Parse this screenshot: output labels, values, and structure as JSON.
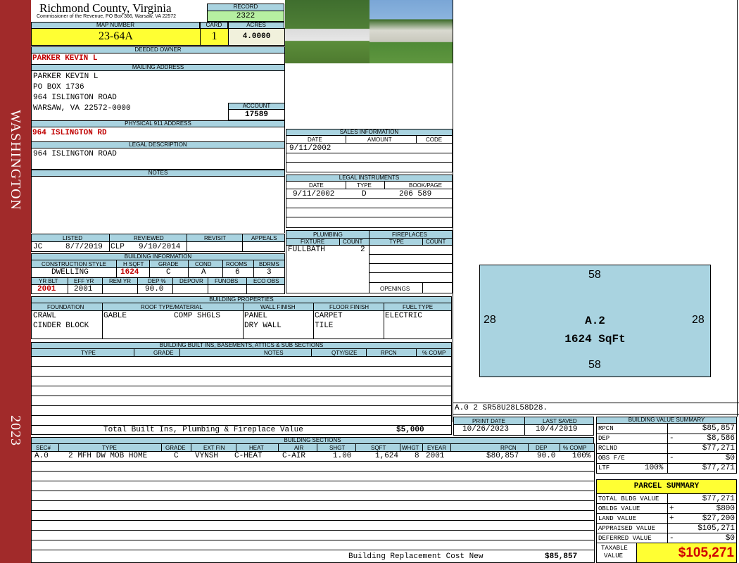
{
  "sidebar": {
    "district": "WASHINGTON",
    "year": "2023"
  },
  "header": {
    "county": "Richmond County, Virginia",
    "commissioner": "Commissioner of the Revenue, PO Box 366, Warsaw, VA 22572",
    "record_label": "RECORD",
    "record": "2322",
    "acres_label": "ACRES",
    "acres": "4.0000",
    "map_label": "MAP NUMBER",
    "map_number": "23-64A",
    "card_label": "CARD",
    "card": "1"
  },
  "owner": {
    "deeded_label": "DEEDED OWNER",
    "deeded": "PARKER KEVIN L",
    "mailing_label": "MAILING ADDRESS",
    "mail": [
      "PARKER KEVIN L",
      "PO BOX 1736",
      "964 ISLINGTON ROAD",
      "WARSAW, VA 22572-0000"
    ],
    "account_label": "ACCOUNT",
    "account": "17589",
    "p911_label": "PHYSICAL 911 ADDRESS",
    "p911": "964 ISLINGTON RD",
    "legal_label": "LEGAL DESCRIPTION",
    "legal": "964 ISLINGTON ROAD",
    "notes_label": "NOTES"
  },
  "sales": {
    "label": "SALES INFORMATION",
    "cols": [
      "DATE",
      "AMOUNT",
      "CODE"
    ],
    "date": "9/11/2002"
  },
  "legal_inst": {
    "label": "LEGAL INSTRUMENTS",
    "cols": [
      "DATE",
      "TYPE",
      "BOOK/PAGE"
    ],
    "date": "9/11/2002",
    "type": "D",
    "book": "206 589"
  },
  "listed": {
    "cols": [
      "LISTED",
      "REVIEWED",
      "REVISIT",
      "APPEALS"
    ],
    "listed_by": "JC",
    "listed_date": "8/7/2019",
    "reviewed_by": "CLP",
    "reviewed_date": "9/10/2014"
  },
  "plumbing": {
    "label": "PLUMBING",
    "fixture_label": "FIXTURE",
    "count_label": "COUNT",
    "fixture": "FULLBATH",
    "count": "2"
  },
  "fireplaces": {
    "label": "FIREPLACES",
    "type_label": "TYPE",
    "count_label": "COUNT",
    "openings_label": "OPENINGS"
  },
  "binfo": {
    "label": "BUILDING INFORMATION",
    "cols1": [
      "CONSTRUCTION STYLE",
      "H SQFT",
      "GRADE",
      "COND",
      "ROOMS",
      "BDRMS"
    ],
    "style": "DWELLING",
    "hsqft": "1624",
    "grade": "C",
    "cond": "A",
    "rooms": "6",
    "bdrms": "3",
    "cols2": [
      "YR BLT",
      "EFF YR",
      "REM YR",
      "DEP %",
      "DEPOVR",
      "FUNOBS",
      "ECO OBS"
    ],
    "yrblt": "2001",
    "effyr": "2001",
    "dep": "90.0"
  },
  "bprops": {
    "label": "BUILDING PROPERTIES",
    "cols": [
      "FOUNDATION",
      "ROOF TYPE/MATERIAL",
      "WALL FINISH",
      "FLOOR FINISH",
      "FUEL TYPE"
    ],
    "found1": "CRAWL",
    "found2": "CINDER BLOCK",
    "roof1": "GABLE",
    "roof2": "COMP SHGLS",
    "wall1": "PANEL",
    "wall2": "DRY WALL",
    "floor1": "CARPET",
    "floor2": "TILE",
    "fuel": "ELECTRIC"
  },
  "builtins": {
    "label": "BUILDING BUILT INS, BASEMENTS, ATTICS & SUB SECTIONS",
    "cols": [
      "TYPE",
      "GRADE",
      "NOTES",
      "QTY/SIZE",
      "RPCN",
      "% COMP"
    ],
    "total_label": "Total Built Ins, Plumbing & Fireplace Value",
    "total": "$5,000"
  },
  "sketch": {
    "top": "58",
    "bottom": "58",
    "left": "28",
    "right": "28",
    "name": "A.2",
    "sqft": "1624 SqFt",
    "code_line": "A.0   2    SR58U28L58D28."
  },
  "print": {
    "print_label": "PRINT DATE",
    "saved_label": "LAST SAVED",
    "print_date": "10/26/2023",
    "saved_date": "10/4/2019"
  },
  "sections": {
    "label": "BUILDING SECTIONS",
    "cols": [
      "SEC#",
      "TYPE",
      "GRADE",
      "EXT FIN",
      "HEAT",
      "AIR",
      "SHGT",
      "SQFT",
      "WHGT",
      "EYEAR",
      "RPCN",
      "DEP",
      "% COMP"
    ],
    "row": [
      "A.0",
      "2 MFH DW MOB HOME",
      "C",
      "VYNSH",
      "C-HEAT",
      "C-AIR",
      "1.00",
      "1,624",
      "8",
      "2001",
      "$80,857",
      "90.0",
      "100%"
    ],
    "brcn_label": "Building Replacement Cost New",
    "brcn": "$85,857"
  },
  "bvs": {
    "label": "BUILDING VALUE SUMMARY",
    "rpcn_l": "RPCN",
    "rpcn": "$85,857",
    "dep_l": "DEP",
    "dep_s": "-",
    "dep": "$8,586",
    "rclnd_l": "RCLND",
    "rclnd": "$77,271",
    "obs_l": "OBS F/E",
    "obs_s": "-",
    "obs": "$0",
    "ltf_l": "LTF",
    "ltf_p": "100%",
    "ltf": "$77,271"
  },
  "parcel": {
    "label": "PARCEL SUMMARY",
    "tbv_l": "TOTAL BLDG VALUE",
    "tbv": "$77,271",
    "obldg_l": "OBLDG VALUE",
    "obldg_s": "+",
    "obldg": "$800",
    "land_l": "LAND VALUE",
    "land_s": "+",
    "land": "$27,200",
    "appr_l": "APPRAISED VALUE",
    "appr": "$105,271",
    "def_l": "DEFERRED VALUE",
    "def_s": "-",
    "def": "$0",
    "tax_l1": "TAXABLE",
    "tax_l2": "VALUE",
    "tax": "$105,271"
  }
}
